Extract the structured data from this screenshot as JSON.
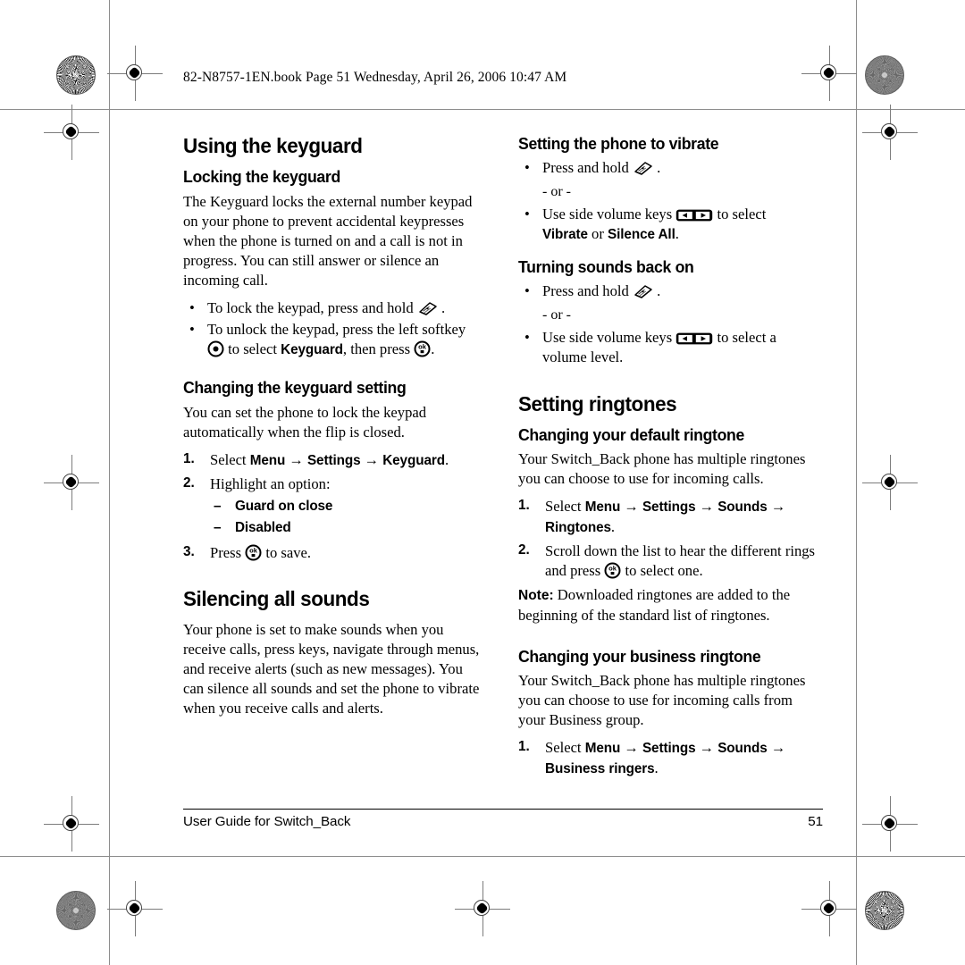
{
  "header": {
    "book_line": "82-N8757-1EN.book  Page 51  Wednesday, April 26, 2006  10:47 AM"
  },
  "left_column": {
    "section_title": "Using the keyguard",
    "locking": {
      "heading": "Locking the keyguard",
      "paragraph": "The Keyguard locks the external number keypad on your phone to prevent accidental keypresses when the phone is turned on and a call is not in progress. You can still answer or silence an incoming call.",
      "bullets": [
        {
          "pre": "To lock the keypad, press and hold",
          "icon": "star-key-icon",
          "post": "."
        },
        {
          "pre": "To unlock the keypad, press the left softkey",
          "icon": "softkey-dot-icon",
          "mid": "to select",
          "ui": "Keyguard",
          "mid2": ", then press",
          "icon2": "ok-key-icon",
          "post": "."
        }
      ]
    },
    "changing_setting": {
      "heading": "Changing the keyguard setting",
      "paragraph": "You can set the phone to lock the keypad automatically when the flip is closed.",
      "steps": [
        {
          "num": "1.",
          "pre": "Select",
          "path": [
            "Menu",
            "Settings",
            "Keyguard"
          ],
          "post": "."
        },
        {
          "num": "2.",
          "pre": "Highlight an option:",
          "options": [
            "Guard on close",
            "Disabled"
          ]
        },
        {
          "num": "3.",
          "pre": "Press",
          "icon": "ok-key-icon",
          "post": "to save."
        }
      ]
    },
    "silencing": {
      "section_title": "Silencing all sounds",
      "paragraph": "Your phone is set to make sounds when you receive calls, press keys, navigate through menus, and receive alerts (such as new messages). You can silence all sounds and set the phone to vibrate when you receive calls and alerts."
    }
  },
  "right_column": {
    "vibrate": {
      "heading": "Setting the phone to vibrate",
      "bullet1_pre": "Press and hold",
      "bullet1_icon": "star-key-icon",
      "bullet1_post": ".",
      "or_label": "- or -",
      "bullet2_pre": "Use side volume keys",
      "bullet2_icon": "volume-rocker-icon",
      "bullet2_mid": "to select",
      "bullet2_ui1": "Vibrate",
      "bullet2_conj": "or",
      "bullet2_ui2": "Silence All",
      "bullet2_post": "."
    },
    "turning_back_on": {
      "heading": "Turning sounds back on",
      "bullet1_pre": "Press and hold",
      "bullet1_icon": "star-key-icon",
      "bullet1_post": ".",
      "or_label": "- or -",
      "bullet2_pre": "Use side volume keys",
      "bullet2_icon": "volume-rocker-icon",
      "bullet2_post": "to select a volume level."
    },
    "ringtones": {
      "section_title": "Setting ringtones",
      "default": {
        "heading": "Changing your default ringtone",
        "paragraph": "Your Switch_Back phone has multiple ringtones you can choose to use for incoming calls.",
        "steps": [
          {
            "num": "1.",
            "pre": "Select",
            "path": [
              "Menu",
              "Settings",
              "Sounds",
              "Ringtones"
            ],
            "post": "."
          },
          {
            "num": "2.",
            "pre": "Scroll down the list to hear the different rings and press",
            "icon": "ok-key-icon",
            "post": "to select one."
          }
        ],
        "note_label": "Note:",
        "note_text": "Downloaded ringtones are added to the beginning of the standard list of ringtones."
      },
      "business": {
        "heading": "Changing your business ringtone",
        "paragraph": "Your Switch_Back phone has multiple ringtones you can choose to use for incoming calls from your Business group.",
        "steps": [
          {
            "num": "1.",
            "pre": "Select",
            "path": [
              "Menu",
              "Settings",
              "Sounds",
              "Business ringers"
            ],
            "post": "."
          }
        ]
      }
    }
  },
  "footer": {
    "guide_label": "User Guide for Switch_Back",
    "page_number": "51"
  },
  "symbols": {
    "bullet": "•",
    "dash": "–",
    "arrow": "→"
  },
  "colors": {
    "text": "#000000",
    "trim_mark": "#8d8d8d"
  }
}
